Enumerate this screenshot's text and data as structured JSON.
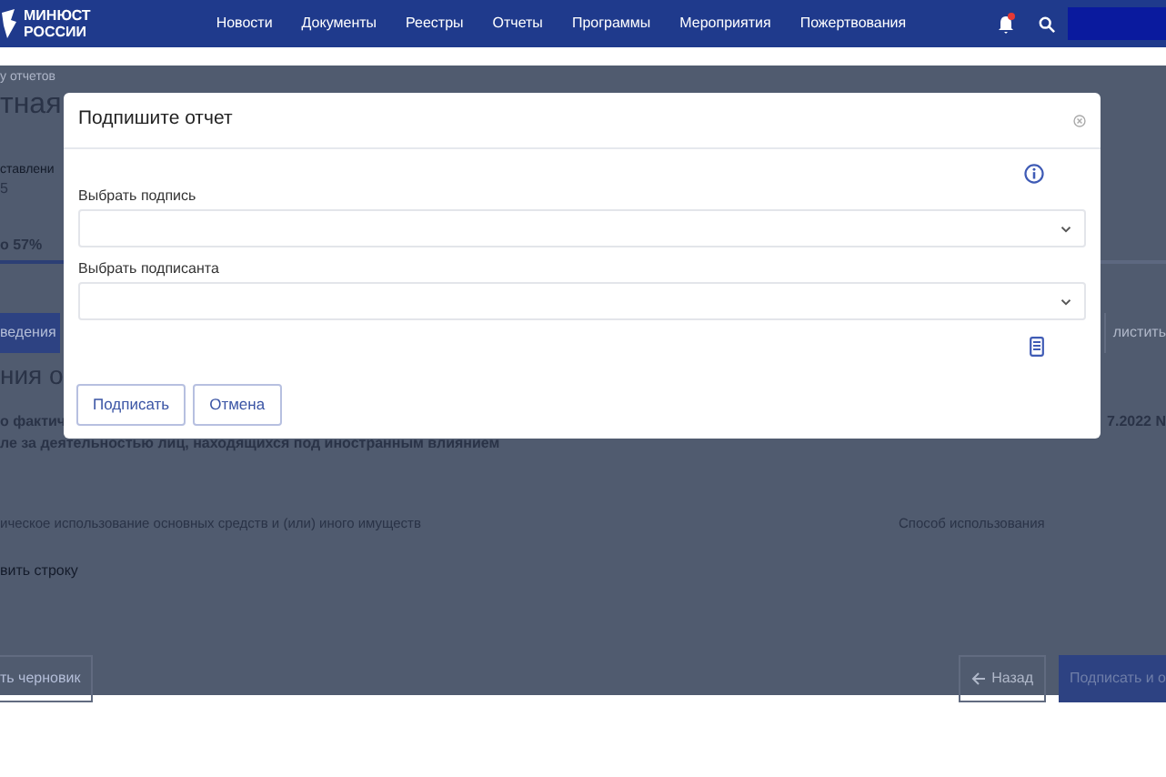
{
  "header": {
    "logo_lines": [
      "МИНЮСТ",
      "РОССИИ"
    ],
    "nav": [
      "Новости",
      "Документы",
      "Реестры",
      "Отчеты",
      "Программы",
      "Мероприятия",
      "Пожертвования"
    ],
    "notifications_unread": true
  },
  "background": {
    "breadcrumb": "у отчетов",
    "heading": "тная",
    "meta_label": "ставлени",
    "meta_value": "5",
    "progress_label": "о 57%",
    "progress": {
      "level": 0.57
    },
    "tab": "ведения",
    "right_button": "листить",
    "section_heading": "ния о",
    "question_start": "о фактич",
    "question_end": "7.2022 N",
    "question_line2": "ле за деятельностью лиц, находящихся под иностранным влиянием",
    "columns": [
      "ическое использование основных средств и (или) иного имуществ",
      "Способ использования"
    ],
    "add_row": "вить строку",
    "draft_button": "ть черновик",
    "back_button": "Назад",
    "submit_button": "Подписать и о"
  },
  "dialog": {
    "title": "Подпишите отчет",
    "fields": [
      {
        "label": "Выбрать подпись"
      },
      {
        "label": "Выбрать подписанта"
      }
    ],
    "buttons": [
      "Подписать",
      "Отмена"
    ]
  }
}
